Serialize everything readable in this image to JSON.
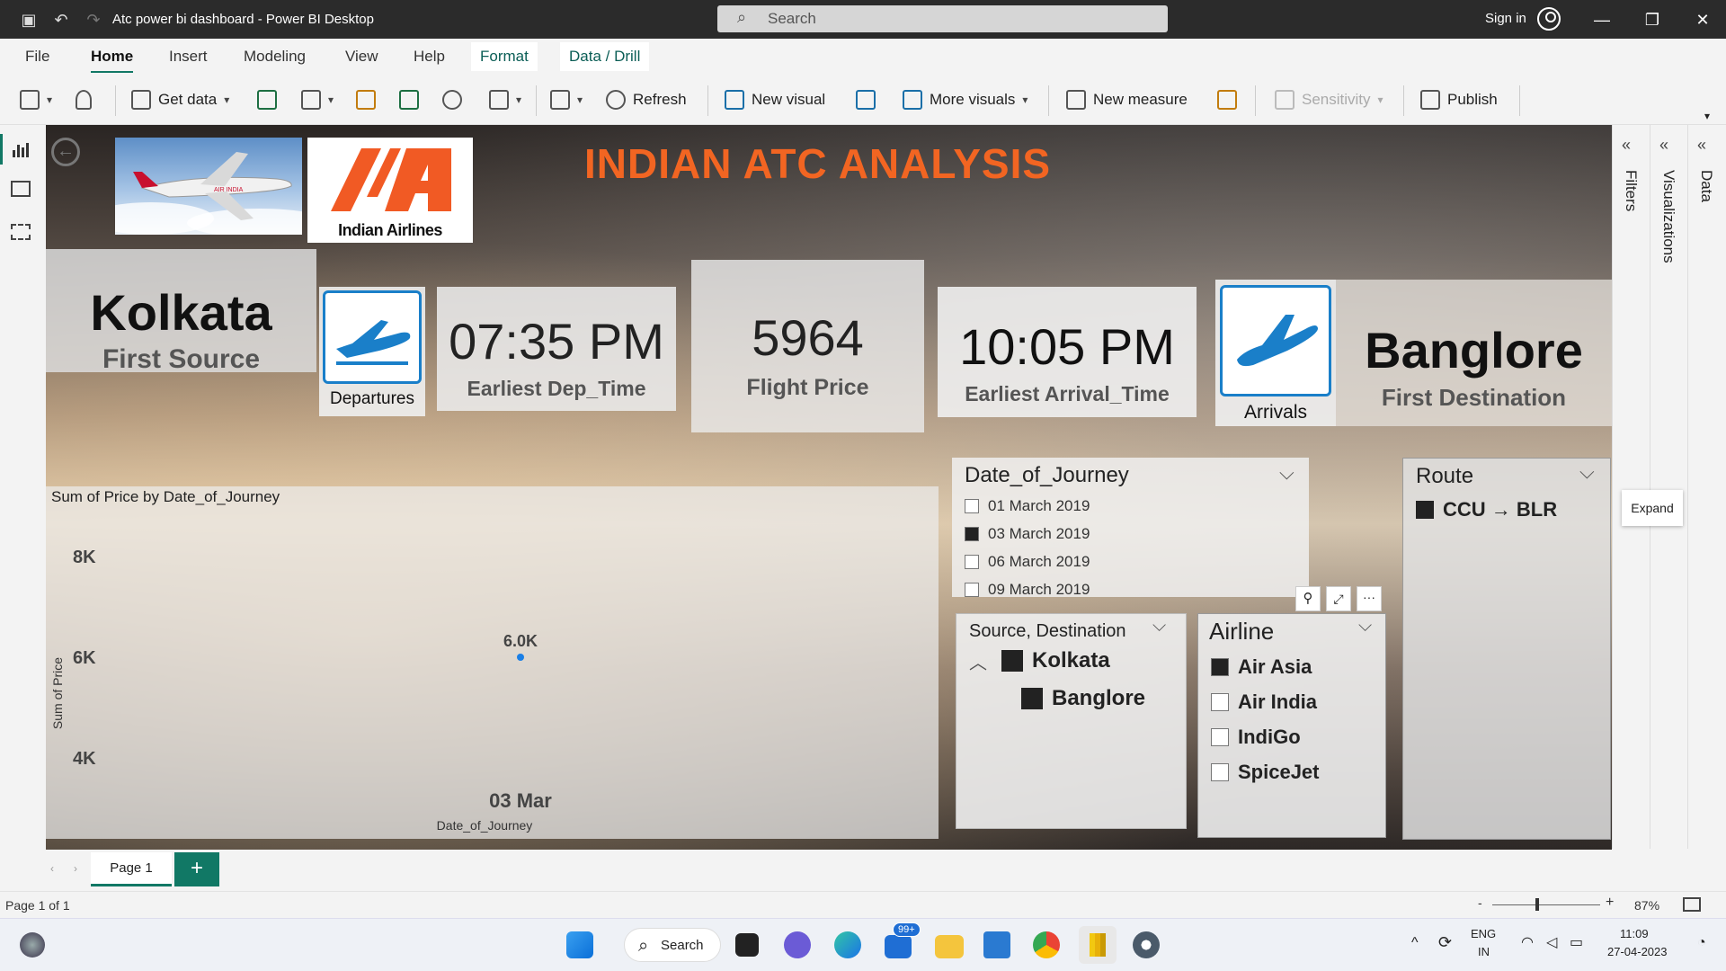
{
  "window": {
    "title": "Atc power bi dashboard - Power BI Desktop",
    "search_placeholder": "Search",
    "sign_in": "Sign in"
  },
  "menu": {
    "tabs": [
      "File",
      "Home",
      "Insert",
      "Modeling",
      "View",
      "Help",
      "Format",
      "Data / Drill"
    ],
    "active": "Home"
  },
  "ribbon": {
    "get_data": "Get data",
    "refresh": "Refresh",
    "new_visual": "New visual",
    "more_visuals": "More visuals",
    "new_measure": "New measure",
    "sensitivity": "Sensitivity",
    "publish": "Publish"
  },
  "report": {
    "title": "INDIAN ATC ANALYSIS",
    "logo_text": "Indian Airlines",
    "first_source_value": "Kolkata",
    "first_source_label": "First Source",
    "departures_label": "Departures",
    "dep_time_value": "07:35 PM",
    "dep_time_label": "Earliest Dep_Time",
    "price_value": "5964",
    "price_label": "Flight Price",
    "arr_time_value": "10:05 PM",
    "arr_time_label": "Earliest Arrival_Time",
    "arrivals_label": "Arrivals",
    "first_dest_value": "Banglore",
    "first_dest_label": "First Destination"
  },
  "chart_data": {
    "type": "scatter",
    "title": "Sum of Price by Date_of_Journey",
    "xlabel": "Date_of_Journey",
    "ylabel": "Sum of Price",
    "y_ticks": [
      "8K",
      "6K",
      "4K"
    ],
    "ylim": [
      3500,
      8500
    ],
    "categories": [
      "03 Mar"
    ],
    "values": [
      6000
    ],
    "data_labels": [
      "6.0K"
    ],
    "color": "#1a7fe6"
  },
  "slicers": {
    "date": {
      "title": "Date_of_Journey",
      "items": [
        {
          "label": "01 March 2019",
          "checked": false
        },
        {
          "label": "03 March 2019",
          "checked": true
        },
        {
          "label": "06 March 2019",
          "checked": false
        },
        {
          "label": "09 March 2019",
          "checked": false
        }
      ]
    },
    "route": {
      "title": "Route",
      "items": [
        {
          "label": "CCU → BLR",
          "checked": true
        }
      ]
    },
    "source_dest": {
      "title": "Source, Destination",
      "parent": "Kolkata",
      "child": "Banglore"
    },
    "airline": {
      "title": "Airline",
      "items": [
        {
          "label": "Air Asia",
          "checked": true
        },
        {
          "label": "Air India",
          "checked": false
        },
        {
          "label": "IndiGo",
          "checked": false
        },
        {
          "label": "SpiceJet",
          "checked": false
        }
      ]
    }
  },
  "panes": {
    "filters": "Filters",
    "visualizations": "Visualizations",
    "data": "Data",
    "expand_tooltip": "Expand"
  },
  "pages": {
    "tab": "Page 1",
    "status": "Page 1 of 1",
    "zoom": "87%"
  },
  "taskbar": {
    "search": "Search",
    "badge": "99+",
    "lang1": "ENG",
    "lang2": "IN",
    "time": "11:09",
    "date": "27-04-2023"
  },
  "colors": {
    "accent": "#117865",
    "title_orange": "#f26522",
    "icon_blue": "#1a7fc9"
  }
}
